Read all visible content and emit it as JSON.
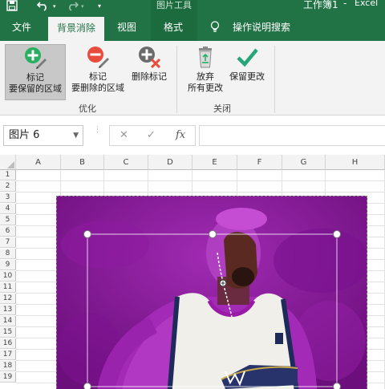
{
  "titlebar": {
    "context_title": "图片工具",
    "doc_title": "工作簿1",
    "dash": "-",
    "app_name": "Excel"
  },
  "tabs": [
    {
      "label": "文件"
    },
    {
      "label": "背景消除",
      "active": true
    },
    {
      "label": "视图"
    },
    {
      "label": "格式"
    },
    {
      "label": "操作说明搜索"
    }
  ],
  "ribbon": {
    "mark_keep": {
      "line1": "标记",
      "line2": "要保留的区域"
    },
    "mark_remove": {
      "line1": "标记",
      "line2": "要删除的区域"
    },
    "delete_mark": {
      "label": "删除标记"
    },
    "discard": {
      "line1": "放弃",
      "line2": "所有更改"
    },
    "keep": {
      "label": "保留更改"
    },
    "group_refine": "优化",
    "group_close": "关闭"
  },
  "formula_bar": {
    "name_box": "图片 6",
    "cancel": "✕",
    "enter": "✓",
    "fx": "fx"
  },
  "grid": {
    "columns": [
      "A",
      "B",
      "C",
      "D",
      "E",
      "F",
      "G",
      "H"
    ],
    "rows": [
      "1",
      "2",
      "3",
      "4",
      "5",
      "6",
      "7",
      "8",
      "9",
      "10",
      "11",
      "12",
      "13",
      "14",
      "15",
      "16",
      "17",
      "18",
      "19"
    ]
  },
  "colors": {
    "accent": "#217346",
    "removal_overlay": "#9b16a8",
    "keep_green": "#27ae60",
    "remove_red": "#e74c3c"
  }
}
